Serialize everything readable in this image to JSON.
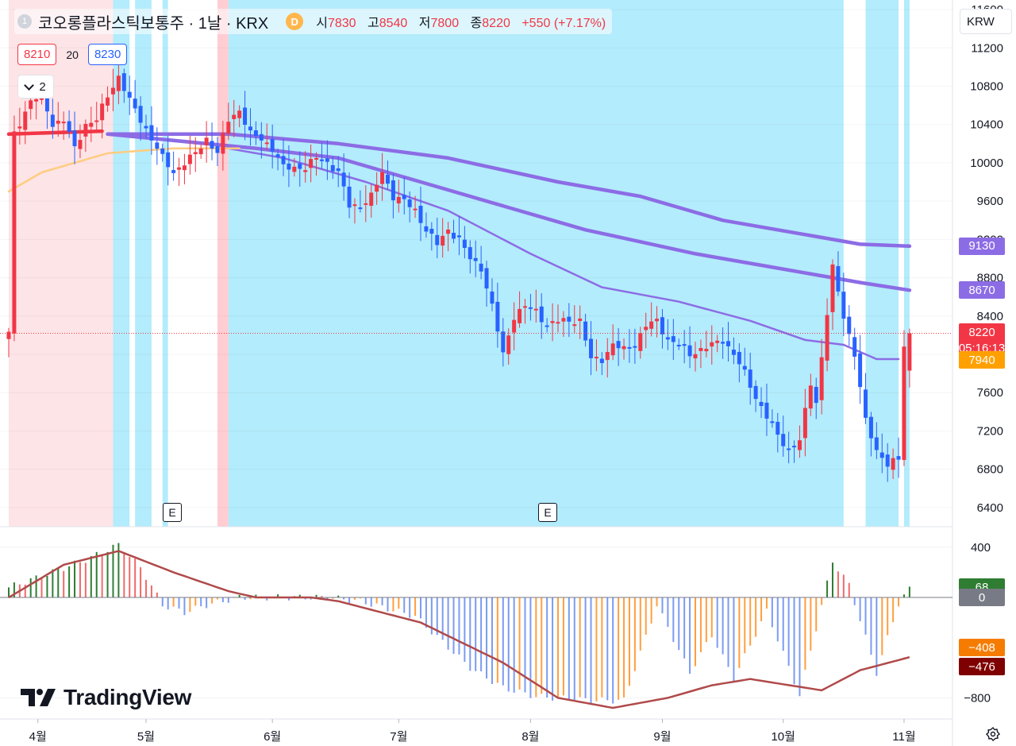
{
  "header": {
    "symbol_index": "1",
    "title": "코오롱플라스틱보통주 · 1날 · KRX",
    "session_badge": "D",
    "ohlc": [
      {
        "label": "시",
        "value": "7830"
      },
      {
        "label": "고",
        "value": "8540"
      },
      {
        "label": "저",
        "value": "7800"
      },
      {
        "label": "종",
        "value": "8220"
      },
      {
        "label": "",
        "value": "+550 (+7.17%)"
      }
    ]
  },
  "order": {
    "bid": "8210",
    "spread": "20",
    "ask": "8230"
  },
  "indicator_toggle": "2",
  "currency_button": "KRW",
  "earnings_marker": "E",
  "brand": "TradingView",
  "colors": {
    "up": "#f23645",
    "down": "#2962ff",
    "ma_purple": "#8c6ce5",
    "ma_red": "#f23645",
    "ma_orange": "#ffcc80",
    "band_pink": "#fde4e6",
    "band_cyan": "#b3ecfc",
    "hist_green": "#2e7d32",
    "hist_blue": "#7b9bf2",
    "hist_orange": "#ff9f40",
    "hist_red": "#f06a6a",
    "macd_line": "#b04a4a"
  },
  "chart_data": [
    {
      "type": "candlestick",
      "title": "",
      "xlabel": "",
      "ylabel": "",
      "x_ticks": [
        "4월",
        "5월",
        "6월",
        "7월",
        "8월",
        "9월",
        "10월",
        "11월"
      ],
      "y_ticks": [
        6400,
        6800,
        7200,
        7600,
        8000,
        8400,
        8800,
        9200,
        9600,
        10000,
        10400,
        10800,
        11200,
        11600
      ],
      "ylim": [
        6200,
        11700
      ],
      "last_price": 8220,
      "countdown": "05:16:13",
      "price_labels": [
        {
          "text": "9130",
          "value": 9130,
          "color": "#8c6ce5"
        },
        {
          "text": "8670",
          "value": 8670,
          "color": "#8c6ce5"
        },
        {
          "text": "7940",
          "value": 7940,
          "color": "#ffa000"
        }
      ],
      "close_path": [
        [
          1,
          10300
        ],
        [
          4,
          10650
        ],
        [
          6,
          10700
        ],
        [
          8,
          10400
        ],
        [
          10,
          10450
        ],
        [
          12,
          10150
        ],
        [
          14,
          10400
        ],
        [
          16,
          10450
        ],
        [
          18,
          10700
        ],
        [
          20,
          10900
        ],
        [
          22,
          10650
        ],
        [
          24,
          10450
        ],
        [
          26,
          10250
        ],
        [
          28,
          10050
        ],
        [
          30,
          9900
        ],
        [
          32,
          10000
        ],
        [
          34,
          10100
        ],
        [
          36,
          10250
        ],
        [
          38,
          10100
        ],
        [
          40,
          10450
        ],
        [
          42,
          10550
        ],
        [
          44,
          10300
        ],
        [
          46,
          10250
        ],
        [
          48,
          10150
        ],
        [
          50,
          9950
        ],
        [
          52,
          9950
        ],
        [
          54,
          9950
        ],
        [
          56,
          10050
        ],
        [
          58,
          10000
        ],
        [
          60,
          9900
        ],
        [
          62,
          9550
        ],
        [
          64,
          9550
        ],
        [
          66,
          9650
        ],
        [
          68,
          9900
        ],
        [
          70,
          9650
        ],
        [
          72,
          9600
        ],
        [
          74,
          9500
        ],
        [
          76,
          9300
        ],
        [
          78,
          9150
        ],
        [
          80,
          9300
        ],
        [
          82,
          9200
        ],
        [
          84,
          9000
        ],
        [
          86,
          8900
        ],
        [
          88,
          8500
        ],
        [
          90,
          8000
        ],
        [
          92,
          8400
        ],
        [
          94,
          8500
        ],
        [
          96,
          8450
        ],
        [
          98,
          8300
        ],
        [
          100,
          8350
        ],
        [
          102,
          8350
        ],
        [
          104,
          8350
        ],
        [
          106,
          7950
        ],
        [
          108,
          7950
        ],
        [
          110,
          8100
        ],
        [
          112,
          8050
        ],
        [
          114,
          8100
        ],
        [
          116,
          8300
        ],
        [
          118,
          8350
        ],
        [
          120,
          8150
        ],
        [
          122,
          8100
        ],
        [
          124,
          8000
        ],
        [
          126,
          8050
        ],
        [
          128,
          8100
        ],
        [
          130,
          8150
        ],
        [
          132,
          8000
        ],
        [
          134,
          7800
        ],
        [
          136,
          7550
        ],
        [
          138,
          7350
        ],
        [
          140,
          7150
        ],
        [
          142,
          7000
        ],
        [
          144,
          7100
        ],
        [
          146,
          7700
        ],
        [
          147,
          7500
        ],
        [
          150,
          8900
        ],
        [
          152,
          8400
        ],
        [
          154,
          8000
        ],
        [
          156,
          7300
        ],
        [
          158,
          7000
        ],
        [
          160,
          6850
        ],
        [
          162,
          6900
        ],
        [
          163,
          8100
        ],
        [
          164,
          8220
        ]
      ],
      "ma_lines": [
        {
          "color": "#8c6ce5",
          "points": [
            [
              18,
              10300
            ],
            [
              40,
              10300
            ],
            [
              60,
              10200
            ],
            [
              80,
              10050
            ],
            [
              100,
              9800
            ],
            [
              115,
              9650
            ],
            [
              130,
              9400
            ],
            [
              145,
              9250
            ],
            [
              155,
              9150
            ],
            [
              164,
              9130
            ]
          ]
        },
        {
          "color": "#8c6ce5",
          "points": [
            [
              18,
              10300
            ],
            [
              45,
              10150
            ],
            [
              60,
              10050
            ],
            [
              75,
              9800
            ],
            [
              90,
              9550
            ],
            [
              105,
              9300
            ],
            [
              125,
              9050
            ],
            [
              140,
              8900
            ],
            [
              155,
              8750
            ],
            [
              164,
              8670
            ]
          ]
        },
        {
          "color": "#8c6ce5",
          "points": [
            [
              40,
              10150
            ],
            [
              50,
              10050
            ],
            [
              65,
              9800
            ],
            [
              80,
              9500
            ],
            [
              95,
              9050
            ],
            [
              108,
              8700
            ],
            [
              122,
              8550
            ],
            [
              135,
              8350
            ],
            [
              145,
              8150
            ],
            [
              152,
              8100
            ],
            [
              158,
              7950
            ],
            [
              162,
              7950
            ]
          ]
        },
        {
          "color": "#f23645",
          "points": [
            [
              0,
              10300
            ],
            [
              17,
              10330
            ]
          ]
        },
        {
          "color": "#ffcc80",
          "points": [
            [
              0,
              9700
            ],
            [
              6,
              9900
            ],
            [
              12,
              10000
            ],
            [
              18,
              10100
            ],
            [
              30,
              10150
            ],
            [
              42,
              10150
            ]
          ]
        }
      ],
      "bands": [
        {
          "from": 0,
          "to": 19,
          "color": "pink"
        },
        {
          "from": 19,
          "to": 22,
          "color": "cyan"
        },
        {
          "from": 23,
          "to": 26,
          "color": "cyan"
        },
        {
          "from": 28,
          "to": 29,
          "color": "cyan"
        },
        {
          "from": 38,
          "to": 40,
          "color": "red"
        },
        {
          "from": 40,
          "to": 152,
          "color": "cyan"
        },
        {
          "from": 156,
          "to": 162,
          "color": "cyan"
        },
        {
          "from": 163,
          "to": 164,
          "color": "cyan"
        }
      ],
      "earnings_at": [
        28,
        90
      ]
    },
    {
      "type": "macd",
      "y_ticks": [
        400,
        0,
        -800
      ],
      "ylim": [
        -1000,
        480
      ],
      "value_labels": [
        {
          "text": "68",
          "value": 68,
          "color": "#2e7d32"
        },
        {
          "text": "0",
          "value": 0,
          "color": "#787b86"
        },
        {
          "text": "−408",
          "value": -408,
          "color": "#f57c00"
        },
        {
          "text": "−476",
          "value": -476,
          "color": "#7f0000"
        }
      ],
      "macd_points": [
        [
          0,
          0
        ],
        [
          10,
          260
        ],
        [
          20,
          370
        ],
        [
          30,
          200
        ],
        [
          40,
          50
        ],
        [
          45,
          0
        ],
        [
          55,
          0
        ],
        [
          60,
          -30
        ],
        [
          75,
          -200
        ],
        [
          90,
          -520
        ],
        [
          100,
          -800
        ],
        [
          110,
          -880
        ],
        [
          120,
          -800
        ],
        [
          128,
          -700
        ],
        [
          135,
          -650
        ],
        [
          148,
          -740
        ],
        [
          155,
          -580
        ],
        [
          164,
          -476
        ]
      ],
      "signal_points": [
        [
          0,
          0
        ],
        [
          18,
          330
        ],
        [
          40,
          100
        ],
        [
          55,
          0
        ],
        [
          164,
          -408
        ]
      ],
      "histogram_points": [
        [
          0,
          80
        ],
        [
          6,
          170
        ],
        [
          14,
          300
        ],
        [
          20,
          420
        ],
        [
          24,
          240
        ],
        [
          28,
          -60
        ],
        [
          32,
          -120
        ],
        [
          36,
          -60
        ],
        [
          42,
          0
        ],
        [
          58,
          0
        ],
        [
          64,
          -30
        ],
        [
          74,
          -150
        ],
        [
          84,
          -560
        ],
        [
          90,
          -720
        ],
        [
          96,
          -790
        ],
        [
          100,
          -800
        ],
        [
          106,
          -820
        ],
        [
          112,
          -820
        ],
        [
          118,
          -60
        ],
        [
          124,
          -600
        ],
        [
          128,
          -300
        ],
        [
          132,
          -650
        ],
        [
          138,
          -110
        ],
        [
          144,
          -780
        ],
        [
          150,
          290
        ],
        [
          153,
          100
        ],
        [
          158,
          -600
        ],
        [
          162,
          -50
        ],
        [
          164,
          68
        ]
      ]
    }
  ]
}
